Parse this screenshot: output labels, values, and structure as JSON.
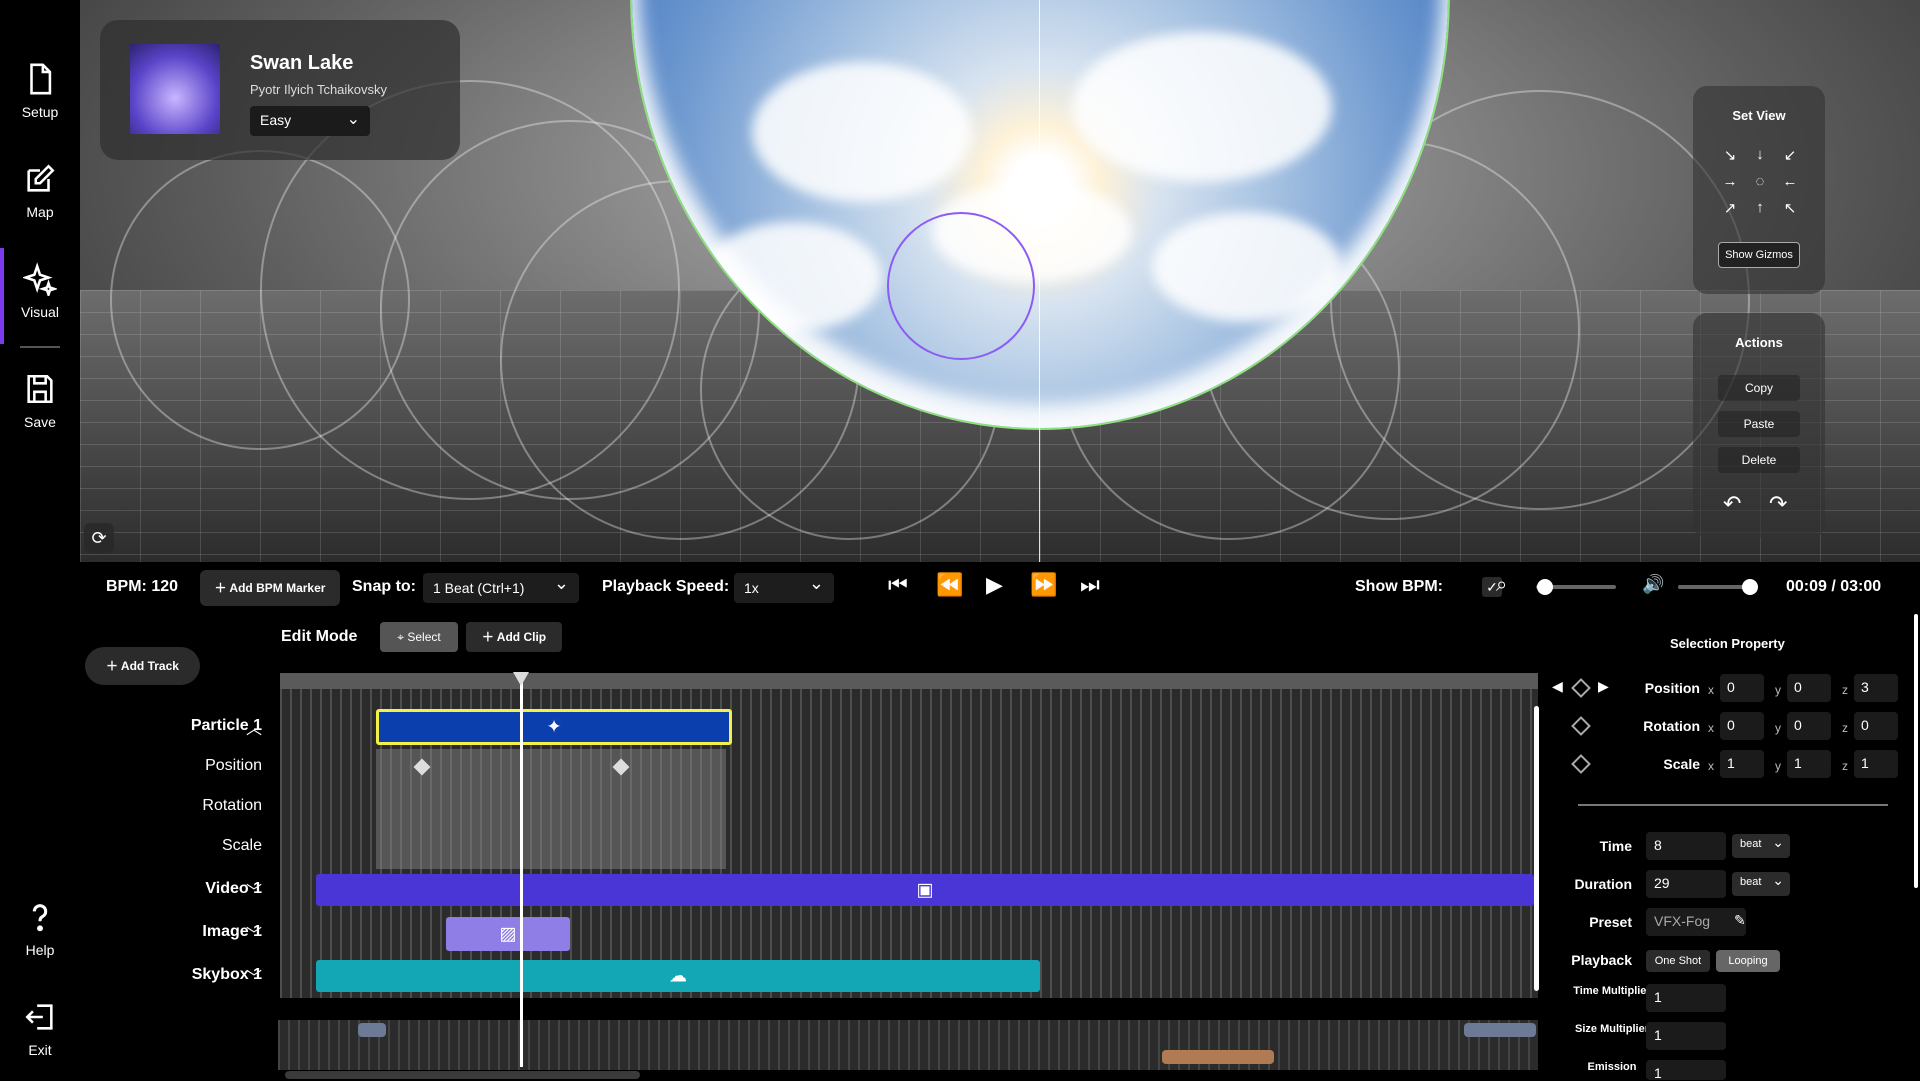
{
  "sidebar": {
    "items": [
      {
        "label": "Setup",
        "icon": "file-icon"
      },
      {
        "label": "Map",
        "icon": "edit-icon"
      },
      {
        "label": "Visual",
        "icon": "sparkle-icon"
      },
      {
        "label": "Save",
        "icon": "save-icon"
      },
      {
        "label": "Help",
        "icon": "question-icon"
      },
      {
        "label": "Exit",
        "icon": "exit-icon"
      }
    ],
    "active": "Visual"
  },
  "song": {
    "title": "Swan Lake",
    "artist": "Pyotr Ilyich Tchaikovsky",
    "difficulty": "Easy"
  },
  "set_view": {
    "title": "Set View",
    "arrows": [
      "↘",
      "↓",
      "↙",
      "→",
      "◌",
      "←",
      "↗",
      "↑",
      "↖"
    ],
    "show_gizmos": "Show Gizmos"
  },
  "actions": {
    "title": "Actions",
    "copy": "Copy",
    "paste": "Paste",
    "delete": "Delete"
  },
  "toolbar": {
    "bpm": "BPM: 120",
    "add_bpm_marker": "Add BPM Marker",
    "snap_label": "Snap to:",
    "snap_value": "1 Beat (Ctrl+1)",
    "speed_label": "Playback Speed:",
    "speed_value": "1x",
    "show_bpm_label": "Show BPM:",
    "show_bpm_checked": true,
    "zoom_level": 0.02,
    "volume_level": 1.0,
    "time": "00:09 / 03:00"
  },
  "edit": {
    "mode_label": "Edit Mode",
    "select": "Select",
    "add_clip": "Add Clip",
    "add_track": "Add Track"
  },
  "tracks": [
    {
      "label": "Particle 1",
      "expanded": true,
      "subtracks": [
        "Position",
        "Rotation",
        "Scale"
      ]
    },
    {
      "label": "Video 1",
      "expanded": false
    },
    {
      "label": "Image 1",
      "expanded": false
    },
    {
      "label": "Skybox 1",
      "expanded": false
    }
  ],
  "colors": {
    "particle_clip": "#0b3fae",
    "video_clip": "#4a36d6",
    "image_clip": "#8f7ee6",
    "skybox_clip": "#13a7b5",
    "accent": "#7c3aed",
    "selected_outline": "#f4f04a"
  },
  "selection_property": {
    "title": "Selection Property",
    "position": {
      "label": "Position",
      "x": "0",
      "y": "0",
      "z": "3"
    },
    "rotation": {
      "label": "Rotation",
      "x": "0",
      "y": "0",
      "z": "0"
    },
    "scale": {
      "label": "Scale",
      "x": "1",
      "y": "1",
      "z": "1"
    },
    "time": {
      "label": "Time",
      "value": "8",
      "unit": "beat"
    },
    "duration": {
      "label": "Duration",
      "value": "29",
      "unit": "beat"
    },
    "preset": {
      "label": "Preset",
      "value": "VFX-Fog"
    },
    "playback": {
      "label": "Playback",
      "one_shot": "One Shot",
      "looping": "Looping"
    },
    "time_multiplier": {
      "label": "Time Multiplier",
      "value": "1"
    },
    "size_multiplier": {
      "label": "Size Multiplier",
      "value": "1"
    },
    "emission": {
      "label": "Emission",
      "value": "1"
    }
  }
}
